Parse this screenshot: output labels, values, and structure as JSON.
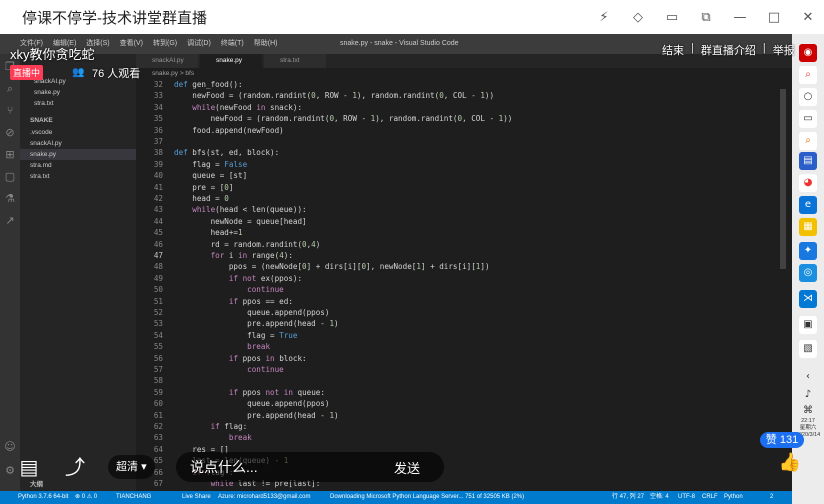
{
  "window": {
    "title": "停课不停学-技术讲堂群直播",
    "controls": [
      "lightning-icon",
      "tag-icon",
      "screen-icon",
      "restore-icon",
      "minimize-icon",
      "maximize-icon",
      "close-icon"
    ]
  },
  "overlay": {
    "streamer": "xky教你贪吃蛇",
    "live_badge": "直播中",
    "viewers": "76 人观看",
    "actions": [
      "结束",
      "群直播介绍",
      "举报"
    ],
    "likes": "赞 131",
    "quality": "超清",
    "comment_placeholder": "说点什么...",
    "send": "发送"
  },
  "vscode": {
    "menu": [
      "文件(F)",
      "编辑(E)",
      "选择(S)",
      "查看(V)",
      "转到(G)",
      "调试(D)",
      "终端(T)",
      "帮助(H)"
    ],
    "window_title": "snake.py - snake - Visual Studio Code",
    "tabs": [
      "snackAI.py",
      "snake.py",
      "stra.txt"
    ],
    "active_tab": "snake.py",
    "breadcrumb": "snake.py > bfs",
    "sidebar": {
      "open_editors": [
        "snackAI.py",
        "snake.py",
        "stra.txt"
      ],
      "folder": "SNAKE",
      "files": [
        ".vscode",
        "snackAI.py",
        "snake.py",
        "stra.md",
        "stra.txt"
      ],
      "selected": "snake.py",
      "outline": "大纲"
    },
    "code": [
      {
        "n": "32",
        "t": "def gen_food():"
      },
      {
        "n": "33",
        "t": "    newFood = (random.randint(0, ROW - 1), random.randint(0, COL - 1))"
      },
      {
        "n": "34",
        "t": "    while(newFood in snack):"
      },
      {
        "n": "35",
        "t": "        newFood = (random.randint(0, ROW - 1), random.randint(0, COL - 1))"
      },
      {
        "n": "36",
        "t": "    food.append(newFood)"
      },
      {
        "n": "37",
        "t": ""
      },
      {
        "n": "38",
        "t": "def bfs(st, ed, block):"
      },
      {
        "n": "39",
        "t": "    flag = False"
      },
      {
        "n": "40",
        "t": "    queue = [st]"
      },
      {
        "n": "41",
        "t": "    pre = [0]"
      },
      {
        "n": "42",
        "t": "    head = 0"
      },
      {
        "n": "43",
        "t": "    while(head < len(queue)):"
      },
      {
        "n": "44",
        "t": "        newNode = queue[head]"
      },
      {
        "n": "45",
        "t": "        head+=1"
      },
      {
        "n": "46",
        "t": "        rd = random.randint(0,4)"
      },
      {
        "n": "47",
        "t": "        for i in range(4):"
      },
      {
        "n": "48",
        "t": "            ppos = (newNode[0] + dirs[i][0], newNode[1] + dirs[i][1])"
      },
      {
        "n": "49",
        "t": "            if not ex(ppos):"
      },
      {
        "n": "50",
        "t": "                continue"
      },
      {
        "n": "51",
        "t": "            if ppos == ed:"
      },
      {
        "n": "52",
        "t": "                queue.append(ppos)"
      },
      {
        "n": "53",
        "t": "                pre.append(head - 1)"
      },
      {
        "n": "54",
        "t": "                flag = True"
      },
      {
        "n": "55",
        "t": "                break"
      },
      {
        "n": "56",
        "t": "            if ppos in block:"
      },
      {
        "n": "57",
        "t": "                continue"
      },
      {
        "n": "58",
        "t": ""
      },
      {
        "n": "59",
        "t": "            if ppos not in queue:"
      },
      {
        "n": "60",
        "t": "                queue.append(ppos)"
      },
      {
        "n": "61",
        "t": "                pre.append(head - 1)"
      },
      {
        "n": "62",
        "t": "        if flag:"
      },
      {
        "n": "63",
        "t": "            break"
      },
      {
        "n": "64",
        "t": "    res = []"
      },
      {
        "n": "65",
        "t": "    last = len(queue) - 1"
      },
      {
        "n": "66",
        "t": "    if flag :"
      },
      {
        "n": "67",
        "t": "        while last != pre[last]:"
      }
    ],
    "current_line": "47",
    "status": {
      "python": "Python 3.7.6 64-bit",
      "problems": "⊗ 0 ⚠ 0",
      "user": "TIANCHANG",
      "live_share": "Live Share",
      "account": "Azure: microhard5133@gmail.com",
      "download": "Downloading Microsoft Python Language Server... 751 of 32505 KB (2%)",
      "position": "行 47, 列 27",
      "spaces": "空格: 4",
      "encoding": "UTF-8",
      "eol": "CRLF",
      "language": "Python",
      "notifications": "2"
    }
  },
  "taskbar": {
    "time": "22:17",
    "weekday": "星期六",
    "date": "2020/3/14"
  },
  "colors": {
    "accent": "#007acc",
    "live_red": "#ff3b55",
    "like_blue": "#1d6ff2",
    "keyword": "#569cd6",
    "control": "#c586c0",
    "function": "#dcdcaa",
    "number": "#b5cea8"
  }
}
